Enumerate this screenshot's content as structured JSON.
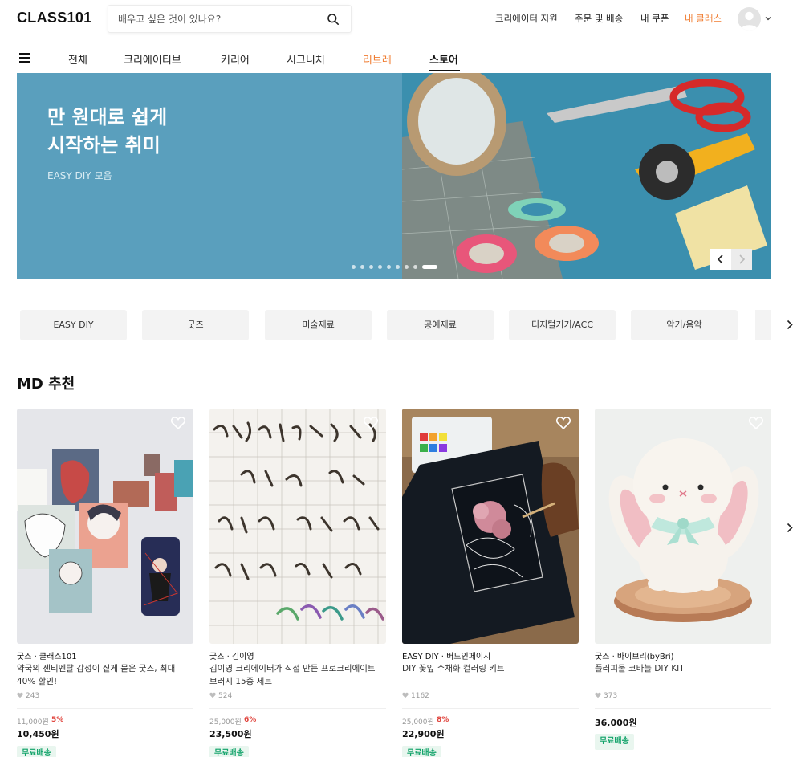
{
  "header": {
    "logo": "CLASS101",
    "search_placeholder": "배우고 싶은 것이 있나요?",
    "links": [
      "크리에이터 지원",
      "주문 및 배송",
      "내 쿠폰",
      "내 클래스"
    ]
  },
  "nav": {
    "categories": [
      "전체",
      "크리에이티브",
      "커리어",
      "시그니처",
      "리브레",
      "스토어"
    ],
    "active": "스토어"
  },
  "hero": {
    "title_line1": "만 원대로 쉽게",
    "title_line2": "시작하는 취미",
    "subtitle": "EASY DIY 모음",
    "slide_count": 9,
    "active_slide": 9
  },
  "chips": [
    "EASY DIY",
    "굿즈",
    "미술재료",
    "공예재료",
    "디지털기기/ACC",
    "악기/음악"
  ],
  "section": {
    "title": "MD 추천"
  },
  "products": [
    {
      "meta": "굿즈 · 클래스101",
      "title": "약국의 센티멘탈 감성이 짙게 묻은 굿즈, 최대 40% 할인!",
      "likes": "243",
      "original_price": "11,000원",
      "discount": "5%",
      "price": "10,450원",
      "badge": "무료배송"
    },
    {
      "meta": "굿즈 · 김이영",
      "title": "김이영 크리에이터가 직접 만든 프로크리에이트 브러시 15종 세트",
      "likes": "524",
      "original_price": "25,000원",
      "discount": "6%",
      "price": "23,500원",
      "badge": "무료배송"
    },
    {
      "meta": "EASY DIY · 버드인페이지",
      "title": "DIY 꽃잎 수채화 컬러링 키트",
      "likes": "1162",
      "original_price": "25,000원",
      "discount": "8%",
      "price": "22,900원",
      "badge": "무료배송"
    },
    {
      "meta": "굿즈 · 바이브리(byBri)",
      "title": "플러피둘 코바늘 DIY KIT",
      "likes": "373",
      "original_price": "",
      "discount": "",
      "price": "36,000원",
      "badge": "무료배송"
    }
  ],
  "colors": {
    "accent": "#f07c30",
    "hero_bg": "#5a9fbd",
    "discount": "#e0433c",
    "badge_text": "#12a36a",
    "badge_bg": "#e9f6ef"
  }
}
